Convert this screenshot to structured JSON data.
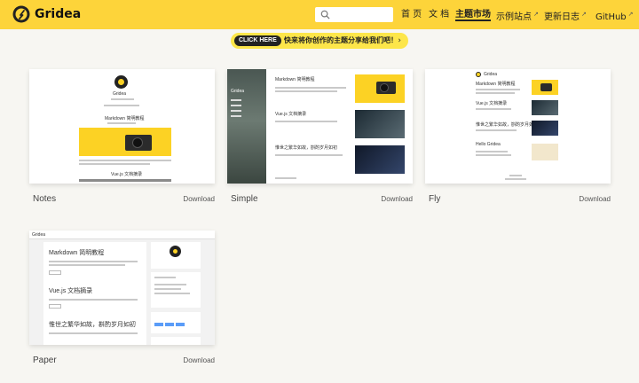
{
  "header": {
    "brand": "Gridea",
    "search_placeholder": "",
    "nav": [
      {
        "label": "首 页",
        "external": false,
        "active": false
      },
      {
        "label": "文 档",
        "external": false,
        "active": false
      },
      {
        "label": "主题市场",
        "external": false,
        "active": true
      },
      {
        "label": "示例站点",
        "external": true,
        "active": false
      },
      {
        "label": "更新日志",
        "external": true,
        "active": false
      },
      {
        "label": "GitHub",
        "external": true,
        "active": false
      }
    ]
  },
  "promo": {
    "pill": "CLICK HERE",
    "message": "快来将你创作的主题分享给我们吧！",
    "chevron": "›"
  },
  "themes": [
    {
      "name": "Notes",
      "download": "Download",
      "preview": {
        "site": "Gridea",
        "post1": "Markdown 简明教程",
        "post2": "Vue.js 文档摘录"
      }
    },
    {
      "name": "Simple",
      "download": "Download",
      "preview": {
        "site": "Gridea",
        "post1": "Markdown 简明教程",
        "post2": "Vue.js 文档摘录",
        "post3": "惟世之繁华如故，斟酌岁月如初"
      }
    },
    {
      "name": "Fly",
      "download": "Download",
      "preview": {
        "site": "Gridea",
        "post1": "Markdown 简明教程",
        "post2": "Vue.js 文档摘录",
        "post3": "惟世之繁华如故，斟酌岁月如初",
        "post4": "Hello Gridea"
      }
    },
    {
      "name": "Paper",
      "download": "Download",
      "preview": {
        "site": "Gridea",
        "post1": "Markdown 简明教程",
        "post2": "Vue.js 文档摘录",
        "post3": "惟世之繁华如故，斟酌岁月如初"
      }
    }
  ],
  "colors": {
    "accent": "#fdd43a",
    "background": "#f7f6f2",
    "promo": "#fde64a"
  }
}
